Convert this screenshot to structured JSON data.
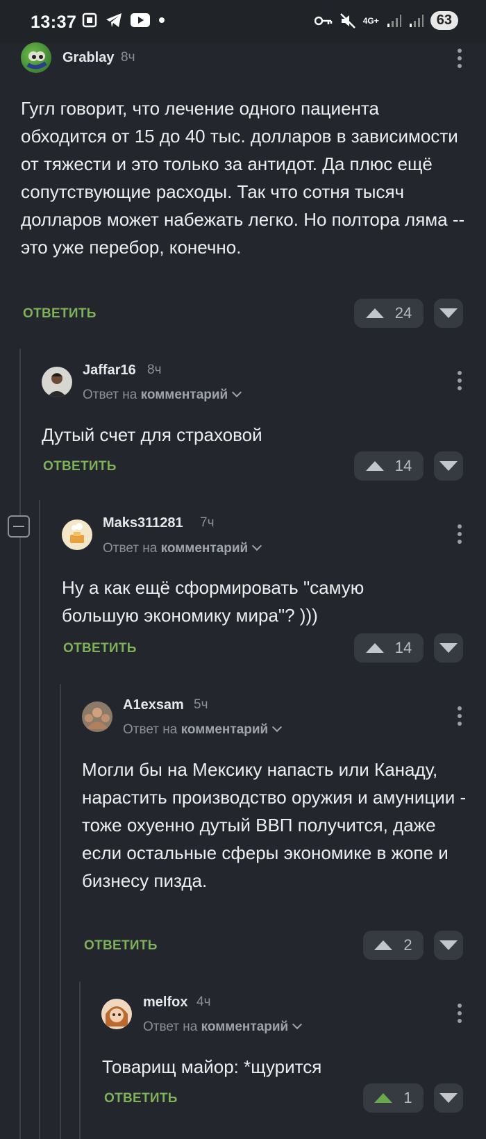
{
  "status_bar": {
    "time": "13:37",
    "battery": "63",
    "network": "4G+"
  },
  "comments": [
    {
      "user": "Grablay",
      "time": "8ч",
      "reply_prefix": "",
      "reply_target": "",
      "text": "Гугл говорит, что лечение одного пациента обходится от 15 до 40 тыс. долларов в зависимости от тяжести и это только за антидот. Да плюс ещё сопутствующие расходы. Так что сотня тысяч долларов может набежать легко. Но полтора ляма -- это уже перебор, конечно.",
      "reply_label": "ОТВЕТИТЬ",
      "votes": "24"
    },
    {
      "user": "Jaffar16",
      "time": "8ч",
      "reply_prefix": "Ответ на",
      "reply_target": "комментарий",
      "text": "Дутый счет для страховой",
      "reply_label": "ОТВЕТИТЬ",
      "votes": "14"
    },
    {
      "user": "Maks311281",
      "time": "7ч",
      "reply_prefix": "Ответ на",
      "reply_target": "комментарий",
      "text": "Ну а как ещё сформировать \"самую большую экономику мира\"? )))",
      "reply_label": "ОТВЕТИТЬ",
      "votes": "14"
    },
    {
      "user": "A1exsam",
      "time": "5ч",
      "reply_prefix": "Ответ на",
      "reply_target": "комментарий",
      "text": "Могли бы на Мексику напасть или Канаду, нарастить производство оружия и амуниции - тоже охуенно дутый ВВП получится, даже если остальные сферы экономике в жопе и бизнесу пизда.",
      "reply_label": "ОТВЕТИТЬ",
      "votes": "2"
    },
    {
      "user": "melfox",
      "time": "4ч",
      "reply_prefix": "Ответ на",
      "reply_target": "комментарий",
      "text": "Товарищ майор: *щурится",
      "reply_label": "ОТВЕТИТЬ",
      "votes": "1"
    }
  ],
  "colors": {
    "background": "#23272d",
    "accent_green": "#7fb05a",
    "upvoted": "#6aa84f"
  }
}
